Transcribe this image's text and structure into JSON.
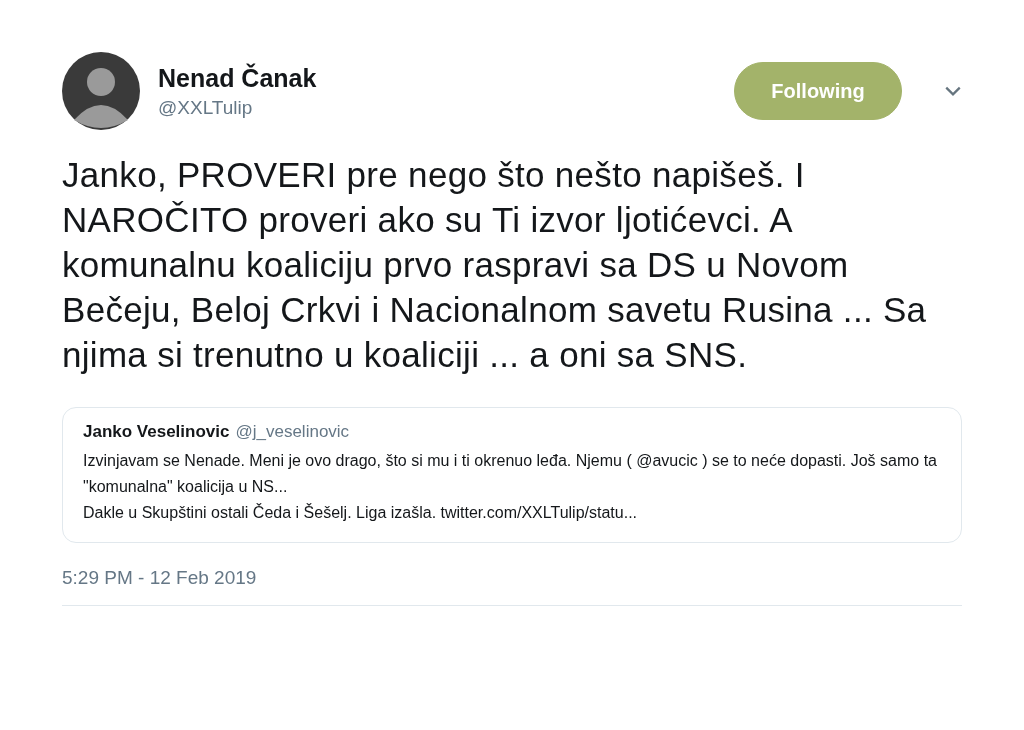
{
  "author": {
    "name": "Nenad Čanak",
    "handle": "@XXLTulip"
  },
  "follow_button": {
    "label": "Following",
    "selected": true
  },
  "tweet_text": "Janko, PROVERI pre nego što nešto napišeš. I NAROČITO proveri ako su Ti izvor ljotićevci. A komunalnu koaliciju prvo raspravi sa DS u Novom Bečeju, Beloj Crkvi i Nacionalnom savetu Rusina ... Sa njima si trenutno u koaliciji ... a oni sa SNS.",
  "quoted_tweet": {
    "name": "Janko Veselinovic",
    "handle": "@j_veselinovic",
    "paragraphs": [
      "Izvinjavam se Nenade. Meni je ovo drago, što si mu i ti okrenuo leđa. Njemu ( @avucic ) se to neće dopasti. Još samo ta \"komunalna\" koalicija u NS...",
      "Dakle u Skupštini ostali Čeda i Šešelj. Liga izašla. twitter.com/XXLTulip/statu..."
    ]
  },
  "timestamp": "5:29 PM - 12 Feb 2019"
}
